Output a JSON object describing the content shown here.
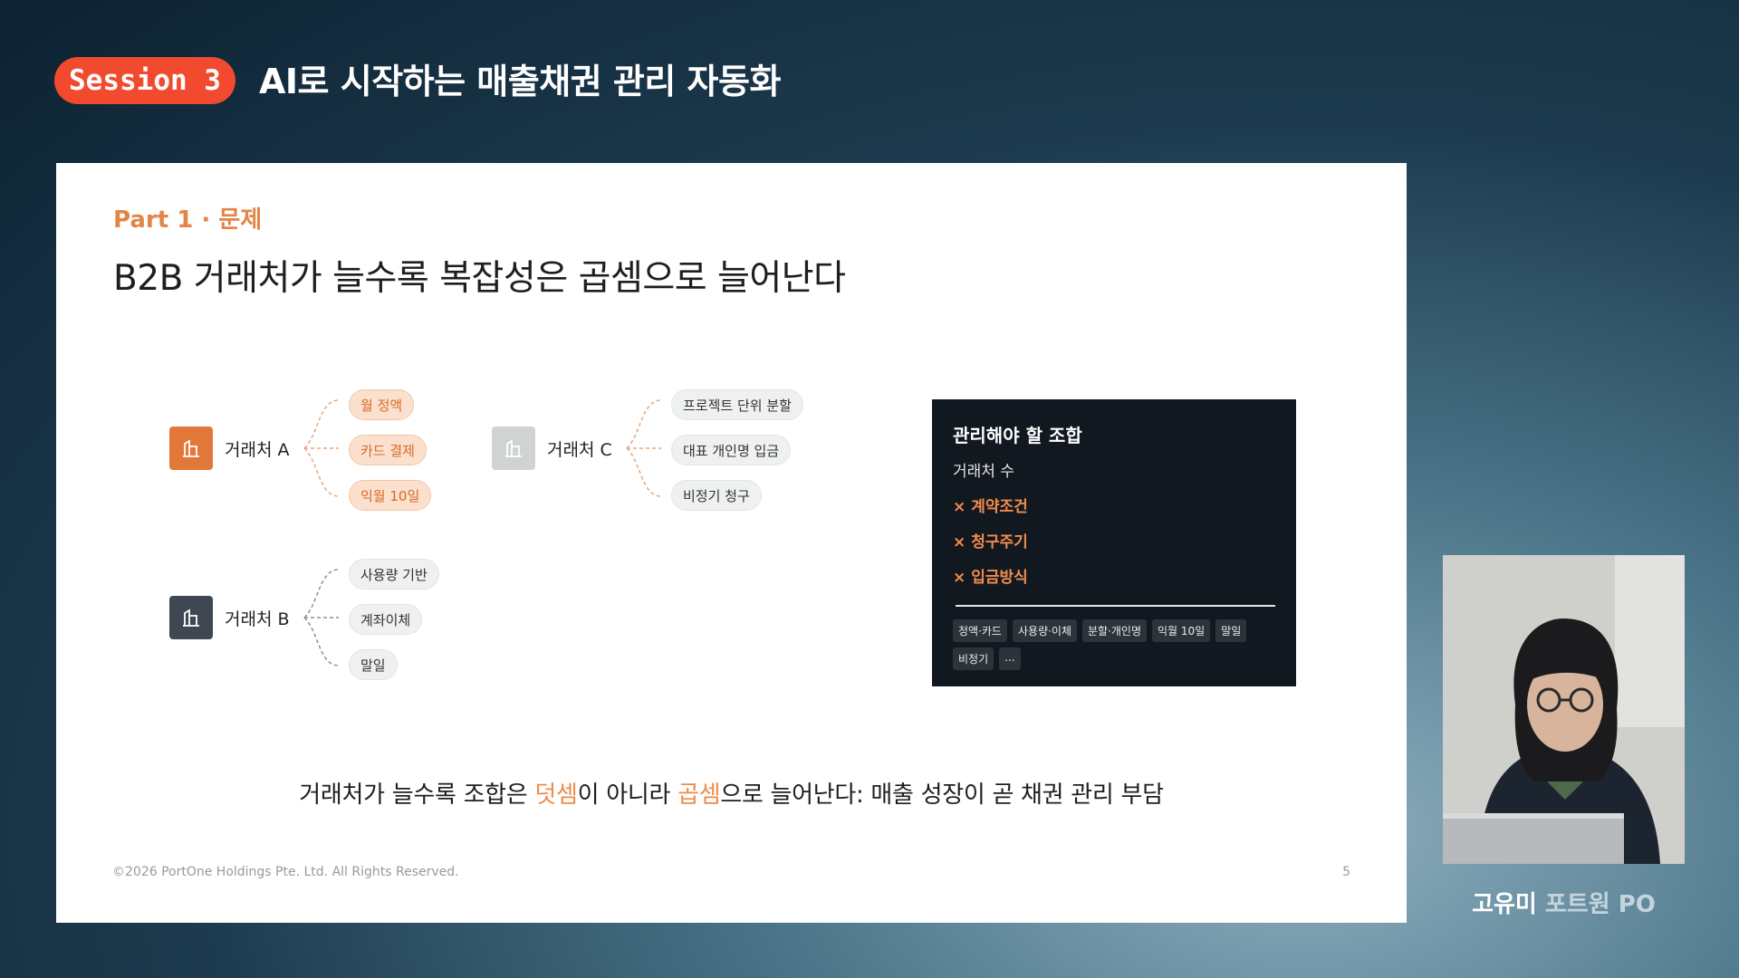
{
  "header": {
    "session_badge": "Session 3",
    "title": "AI로 시작하는 매출채권 관리 자동화"
  },
  "slide": {
    "part_label": "Part 1 · 문제",
    "heading": "B2B 거래처가 늘수록 복잡성은 곱셈으로 늘어난다",
    "clients": [
      {
        "name": "거래처 A",
        "icon": "building-icon",
        "color": "#e2773a",
        "items": [
          "월 정액",
          "카드 결제",
          "익월 10일"
        ]
      },
      {
        "name": "거래처 B",
        "icon": "building-icon",
        "color": "#3f4852",
        "items": [
          "사용량 기반",
          "계좌이체",
          "말일"
        ]
      },
      {
        "name": "거래처 C",
        "icon": "building-icon",
        "color": "#d0d3d4",
        "items": [
          "프로젝트 단위 분할",
          "대표 개인명 입금",
          "비정기 청구"
        ]
      }
    ],
    "panel": {
      "title": "관리해야 할 조합",
      "subtitle": "거래처 수",
      "factor_symbol": "×",
      "factors": [
        "계약조건",
        "청구주기",
        "입금방식"
      ],
      "tags": [
        "정액·카드",
        "사용량·이체",
        "분할·개인명",
        "익월 10일",
        "말일",
        "비정기",
        "..."
      ]
    },
    "bottom_line": {
      "part1": "거래처가 늘수록 조합은 ",
      "accent1": "덧셈",
      "part2": "이 아니라 ",
      "accent2": "곱셈",
      "part3": "으로 늘어난다: 매출 성장이 곧 채권 관리 부담"
    },
    "copyright": "©2026 PortOne Holdings Pte. Ltd. All Rights Reserved.",
    "page_number": "5"
  },
  "speaker": {
    "name": "고유미",
    "role": "포트원 PO"
  },
  "colors": {
    "accent_orange": "#f14a2e",
    "chip_orange_text": "#d9692a",
    "panel_bg": "#121820"
  }
}
